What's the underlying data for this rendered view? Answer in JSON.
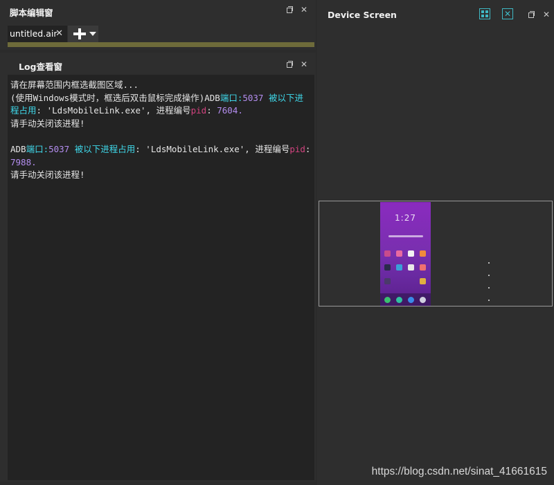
{
  "script_pane": {
    "title": "脚本编辑窗",
    "tab_label": "untitled.air",
    "tab_close": "✕",
    "close_glyph": "✕"
  },
  "log_pane": {
    "title": "Log查看窗",
    "close_glyph": "✕",
    "lines": [
      {
        "text": "请在屏幕范围内框选截图区域..."
      },
      {
        "parts": [
          {
            "t": "(使用Windows模式时，框选后双击鼠标完成操作)ADB"
          },
          {
            "t": "端口:",
            "cls": "c"
          },
          {
            "t": "5037",
            "cls": "n"
          },
          {
            "t": " 被以下进程占用",
            "cls": "c"
          },
          {
            "t": ": 'LdsMobileLink.exe', 进程编号"
          },
          {
            "t": "pid",
            "cls": "p"
          },
          {
            "t": ": "
          },
          {
            "t": "7604.",
            "cls": "n"
          }
        ]
      },
      {
        "text": "请手动关闭该进程!"
      },
      {
        "text": ""
      },
      {
        "parts": [
          {
            "t": "ADB"
          },
          {
            "t": "端口:",
            "cls": "c"
          },
          {
            "t": "5037",
            "cls": "n"
          },
          {
            "t": " 被以下进程占用",
            "cls": "c"
          },
          {
            "t": ": 'LdsMobileLink.exe', 进程编号"
          },
          {
            "t": "pid",
            "cls": "p"
          },
          {
            "t": ": "
          },
          {
            "t": "7988.",
            "cls": "n"
          }
        ]
      },
      {
        "text": "请手动关闭该进程!"
      }
    ]
  },
  "device_pane": {
    "title": "Device Screen",
    "close_glyph": "✕",
    "icons": [
      "grid-icon",
      "tools-icon",
      "restore-icon",
      "close-icon"
    ],
    "phone_clock": "1:27"
  },
  "watermark": "https://blog.csdn.net/sinat_41661615",
  "colors": {
    "accent": "#3fb8c4",
    "port_text": "#3fd8ea",
    "pid_text": "#d1437e",
    "number_text": "#b48ef0"
  }
}
